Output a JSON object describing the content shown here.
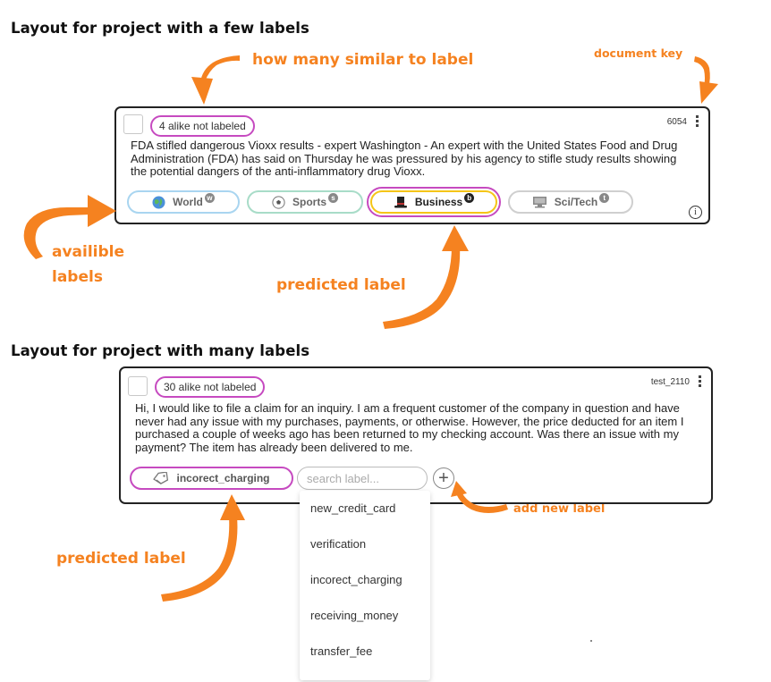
{
  "headings": {
    "few_labels": "Layout for project with a few labels",
    "many_labels": "Layout for project with many labels"
  },
  "annotations": {
    "similar": "how many similar to label",
    "doc_key": "document key",
    "available_line1": "availible",
    "available_line2": "labels",
    "predicted_top": "predicted label",
    "predicted_bottom": "predicted label",
    "add_new": "add new label"
  },
  "card1": {
    "alike": "4 alike not labeled",
    "doc_key": "6054",
    "text": "FDA stifled dangerous Vioxx results - expert Washington - An expert with the United States Food and Drug Administration (FDA) has said on Thursday he was pressured by his agency to stifle study results showing the potential dangers of the anti-inflammatory drug Vioxx.",
    "labels": [
      {
        "name": "World",
        "key": "w",
        "icon": "globe-icon",
        "state": "available"
      },
      {
        "name": "Sports",
        "key": "s",
        "icon": "soccer-ball-icon",
        "state": "available"
      },
      {
        "name": "Business",
        "key": "b",
        "icon": "top-hat-icon",
        "state": "predicted"
      },
      {
        "name": "Sci/Tech",
        "key": "t",
        "icon": "computer-icon",
        "state": "available"
      }
    ],
    "info": "i"
  },
  "card2": {
    "alike": "30 alike not labeled",
    "doc_key": "test_2110",
    "text": "Hi, I would like to file a claim for an inquiry. I am a frequent customer of the company in question and have never had any issue with my purchases, payments, or otherwise. However, the price deducted for an item I purchased a couple of weeks ago has been returned to my checking account. Was there an issue with my payment? The item has already been delivered to me.",
    "predicted_label": "incorect_charging",
    "search_placeholder": "search label...",
    "add": "+",
    "dropdown": [
      "new_credit_card",
      "verification",
      "incorect_charging",
      "receiving_money",
      "transfer_fee"
    ]
  },
  "colors": {
    "annotation": "#f58220",
    "predicted_border": "#c64ac0",
    "predicted_inner": "#f5c518",
    "world_border": "#a9d5f0",
    "sports_border": "#a8dcc8",
    "scitech_border": "#cfcfcf"
  }
}
